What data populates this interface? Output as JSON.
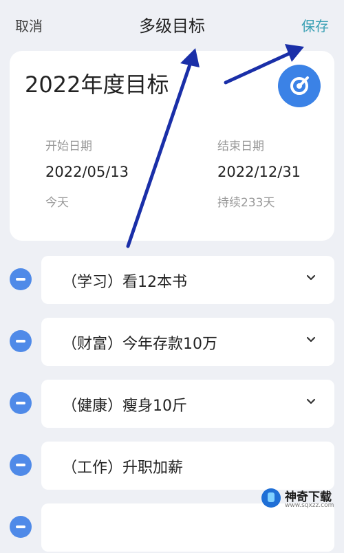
{
  "header": {
    "cancel": "取消",
    "title": "多级目标",
    "save": "保存"
  },
  "goal": {
    "title": "2022年度目标",
    "start": {
      "label": "开始日期",
      "date": "2022/05/13",
      "note": "今天"
    },
    "end": {
      "label": "结束日期",
      "date": "2022/12/31",
      "note": "持续233天"
    }
  },
  "items": [
    {
      "text": "（学习）看12本书"
    },
    {
      "text": "（财富）今年存款10万"
    },
    {
      "text": "（健康）瘦身10斤"
    },
    {
      "text": "（工作）升职加薪"
    }
  ],
  "watermark": {
    "title": "神奇下载",
    "url": "www.sqxzz.com"
  },
  "colors": {
    "accent": "#3aa0b4",
    "primary": "#3b82e6",
    "arrow": "#1a2fa8",
    "bg": "#eef0f5"
  }
}
